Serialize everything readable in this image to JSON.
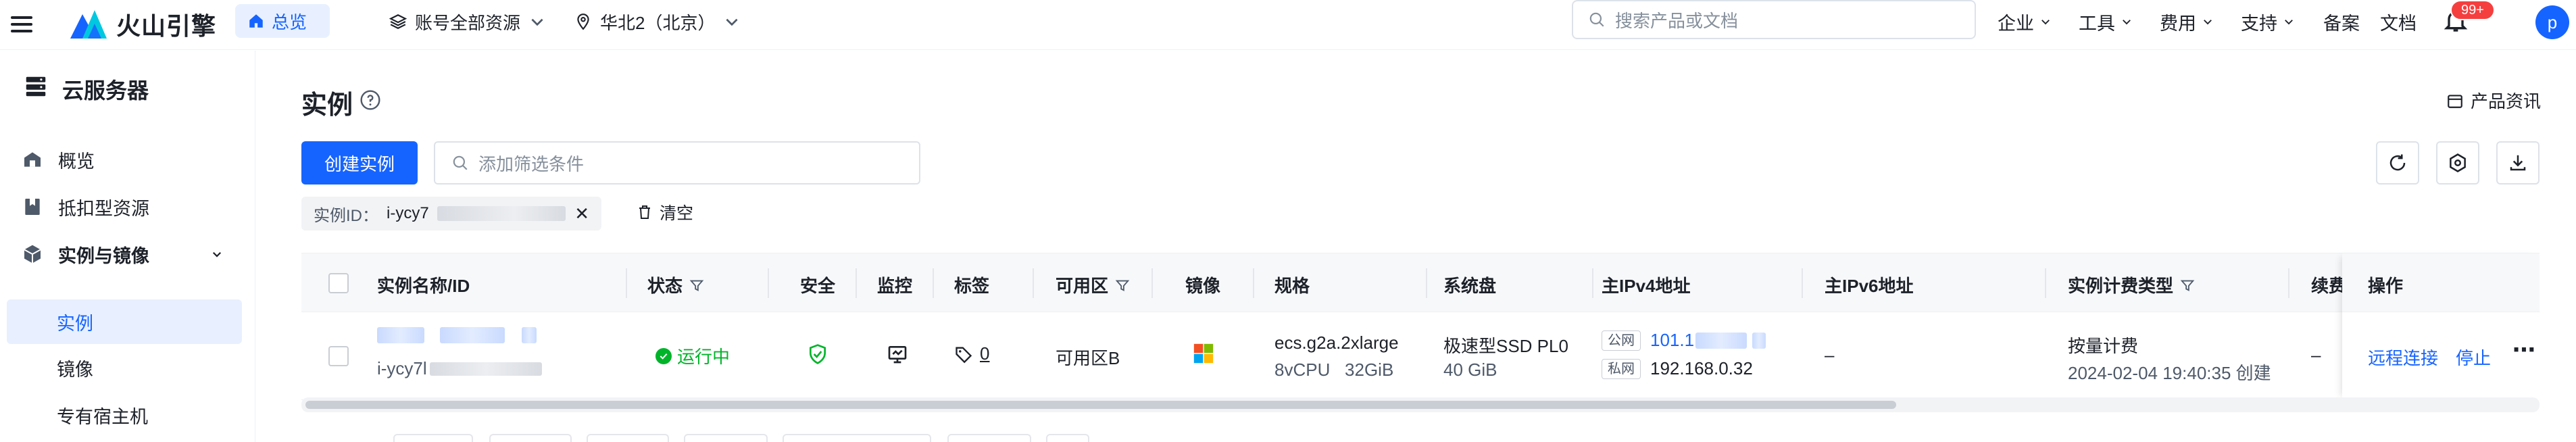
{
  "topbar": {
    "logo_text": "火山引擎",
    "home_label": "总览",
    "account_select": "账号全部资源",
    "region_select": "华北2（北京）",
    "search_placeholder": "搜索产品或文档",
    "nav": [
      "企业",
      "工具",
      "费用",
      "支持",
      "备案",
      "文档"
    ],
    "notification_badge": "99+",
    "avatar_letter": "p"
  },
  "sidebar": {
    "title": "云服务器",
    "items": [
      {
        "label": "概览",
        "icon": "building-icon"
      },
      {
        "label": "抵扣型资源",
        "icon": "bookmark-icon"
      },
      {
        "label": "实例与镜像",
        "icon": "cube-icon"
      }
    ],
    "sub_items": [
      {
        "label": "实例",
        "active": true
      },
      {
        "label": "镜像",
        "active": false
      },
      {
        "label": "专有宿主机",
        "active": false
      }
    ]
  },
  "main": {
    "title": "实例",
    "product_info": "产品资讯",
    "create_button": "创建实例",
    "filter_placeholder": "添加筛选条件",
    "filter_tag_label": "实例ID：",
    "filter_tag_value": "i-ycy7",
    "clear_label": "清空"
  },
  "table": {
    "columns": [
      "实例名称/ID",
      "状态",
      "安全",
      "监控",
      "标签",
      "可用区",
      "镜像",
      "规格",
      "系统盘",
      "主IPv4地址",
      "主IPv6地址",
      "实例计费类型",
      "续费",
      "操作"
    ],
    "row": {
      "id_prefix": "i-ycy7l",
      "status": "运行中",
      "tag_count": "0",
      "zone": "可用区B",
      "spec": "ecs.g2a.2xlarge",
      "spec_detail": "8vCPU   32GiB",
      "disk": "极速型SSD PL0",
      "disk_size": "40 GiB",
      "public_label": "公网",
      "public_ip": "101.1",
      "private_label": "私网",
      "private_ip": "192.168.0.32",
      "ipv6": "–",
      "billing": "按量计费",
      "created": "2024-02-04 19:40:35 创建",
      "renew": "–",
      "action_remote": "远程连接",
      "action_stop": "停止"
    }
  },
  "colors": {
    "accent": "#1664ff",
    "running": "#00b42a",
    "badge": "#f53f3f"
  }
}
